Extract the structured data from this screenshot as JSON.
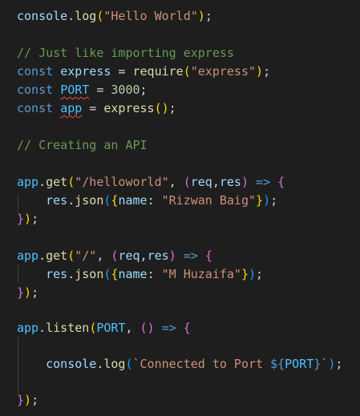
{
  "editor": {
    "language": "javascript",
    "background": "#1e1e1e",
    "line1": {
      "obj": "console",
      "dot": ".",
      "fn": "log",
      "open": "(",
      "str": "\"Hello World\"",
      "close": ")",
      "semi": ";"
    },
    "line3": {
      "text": "// Just like importing express"
    },
    "line4": {
      "kw": "const",
      "name": "express",
      "eq": " = ",
      "fn": "require",
      "open": "(",
      "str": "\"express\"",
      "close": ")",
      "semi": ";"
    },
    "line5": {
      "kw": "const",
      "name": "PORT",
      "eq": " = ",
      "num": "3000",
      "semi": ";"
    },
    "line6": {
      "kw": "const",
      "name": "app",
      "eq": " = ",
      "fn": "express",
      "open": "(",
      "close": ")",
      "semi": ";"
    },
    "line8": {
      "text": "// Creating an API"
    },
    "line10": {
      "obj": "app",
      "dot": ".",
      "fn": "get",
      "open": "(",
      "str": "\"/helloworld\"",
      "comma": ", ",
      "popen": "(",
      "p1": "req",
      "pcomma": ",",
      "p2": "res",
      "pclose": ")",
      "arrow": " => ",
      "brace": "{"
    },
    "line11": {
      "indent": "    ",
      "obj": "res",
      "dot": ".",
      "fn": "json",
      "open": "(",
      "bopen": "{",
      "key": "name",
      "colon": ": ",
      "str": "\"Rizwan Baig\"",
      "bclose": "}",
      "close": ")",
      "semi": ";"
    },
    "line12": {
      "brace": "}",
      "close": ")",
      "semi": ";"
    },
    "line14": {
      "obj": "app",
      "dot": ".",
      "fn": "get",
      "open": "(",
      "str": "\"/\"",
      "comma": ", ",
      "popen": "(",
      "p1": "req",
      "pcomma": ",",
      "p2": "res",
      "pclose": ")",
      "arrow": " => ",
      "brace": "{"
    },
    "line15": {
      "indent": "    ",
      "obj": "res",
      "dot": ".",
      "fn": "json",
      "open": "(",
      "bopen": "{",
      "key": "name",
      "colon": ": ",
      "str": "\"M Huzaifa\"",
      "bclose": "}",
      "close": ")",
      "semi": ";"
    },
    "line16": {
      "brace": "}",
      "close": ")",
      "semi": ";"
    },
    "line18": {
      "obj": "app",
      "dot": ".",
      "fn": "listen",
      "open": "(",
      "arg": "PORT",
      "comma": ", ",
      "popen": "(",
      "pclose": ")",
      "arrow": " => ",
      "brace": "{"
    },
    "line20": {
      "indent": "    ",
      "obj": "console",
      "dot": ".",
      "fn": "log",
      "open": "(",
      "tpl1": "`Connected to Port ",
      "dollar": "${",
      "tvar": "PORT",
      "tclose": "}",
      "tpl2": "`",
      "close": ")",
      "semi": ";"
    },
    "line22": {
      "brace": "}",
      "close": ")",
      "semi": ";"
    }
  }
}
